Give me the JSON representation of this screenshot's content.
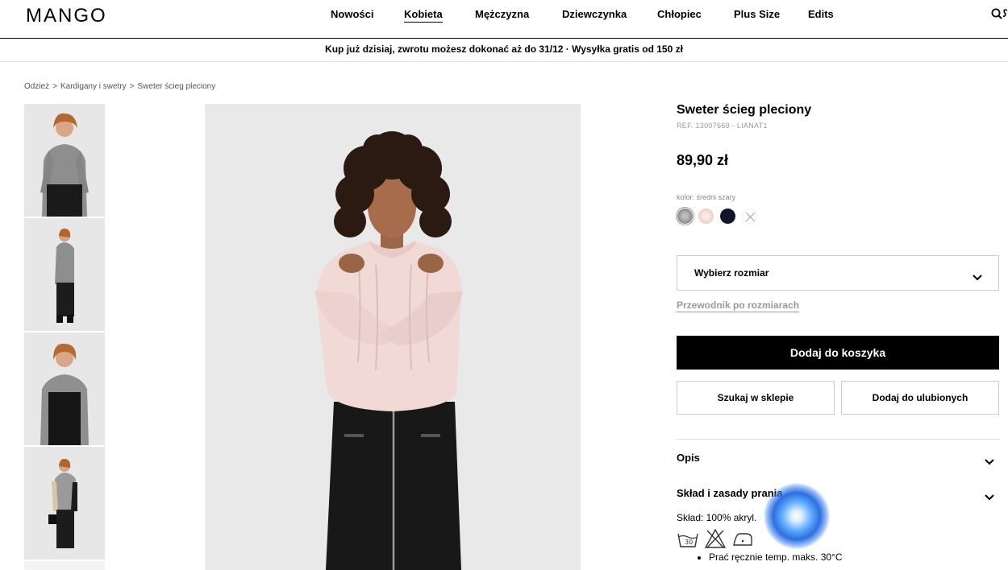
{
  "header": {
    "logo": "MANGO",
    "nav": [
      "Nowości",
      "Kobieta",
      "Mężczyzna",
      "Dziewczynka",
      "Chłopiec",
      "Plus Size",
      "Edits"
    ],
    "active_nav": "Kobieta"
  },
  "promo": {
    "text": "Kup już dzisiaj, zwrotu możesz dokonać aż do 31/12 · Wysyłka gratis od 150 zł"
  },
  "breadcrumb": [
    "Odzież",
    "Kardigany i swetry",
    "Sweter ścieg pleciony"
  ],
  "product": {
    "name": "Sweter ścieg pleciony",
    "ref": "REF. 13007669 - LIANAT1",
    "price": "89,90 zł",
    "color_label": "kolor: średni szary",
    "swatches": [
      {
        "name": "średni szary",
        "color": "#9a9a9a",
        "selected": true
      },
      {
        "name": "różowy",
        "color": "#f3dcd6",
        "selected": false
      },
      {
        "name": "granatowy",
        "color": "#12152a",
        "selected": false
      },
      {
        "name": "niedostępny",
        "color": "#ffffff",
        "selected": false
      }
    ]
  },
  "actions": {
    "size_select": "Wybierz rozmiar",
    "size_guide": "Przewodnik po rozmiarach",
    "add_to_cart": "Dodaj do koszyka",
    "find_in_store": "Szukaj w sklepie",
    "add_to_favorites": "Dodaj do ulubionych"
  },
  "details": {
    "description_label": "Opis",
    "composition_label": "Skład i zasady prania",
    "composition": "Skład: 100% akryl.",
    "care": [
      "Prać ręcznie temp. maks. 30°C"
    ]
  },
  "colors": {
    "accent": "#000000",
    "border": "#cccccc",
    "muted": "#999999"
  }
}
